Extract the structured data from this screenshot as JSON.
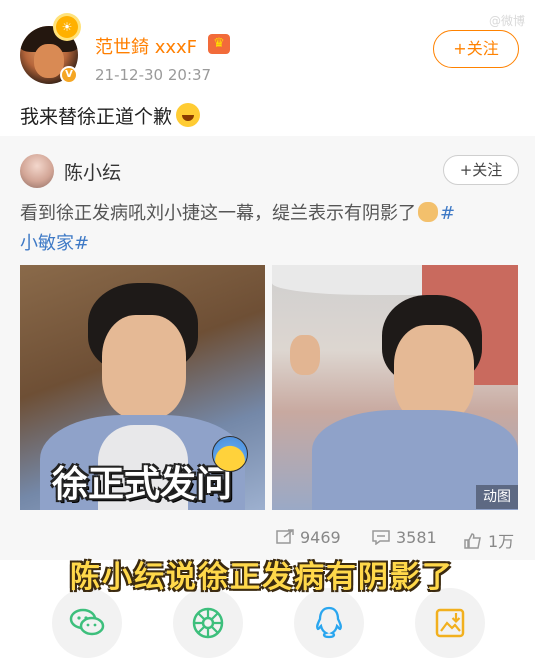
{
  "watermark": "@微博",
  "post": {
    "username": "范世錡 xxxF",
    "timestamp": "21-12-30 20:37",
    "follow_label": "+关注",
    "text": "我来替徐正道个歉"
  },
  "repost": {
    "username": "陈小纭",
    "follow_label": "+关注",
    "text_main": "看到徐正发病吼刘小捷这一幕，缇兰表示有阴影了",
    "hashtag_part1": "#",
    "hashtag_part2": "小敏家#",
    "image_left_caption": "徐正式发问",
    "gif_badge": "动图"
  },
  "stats": {
    "reposts": "9469",
    "comments": "3581",
    "likes": "1万"
  },
  "subtitle": "陈小纭说徐正发病有阴影了",
  "share": {
    "items": [
      "wechat-icon",
      "moments-icon",
      "qq-icon",
      "save-image-icon"
    ]
  },
  "colors": {
    "accent": "#ff8200",
    "hashtag": "#3f7ac6",
    "wechat": "#3dbf7c",
    "moments": "#3dbf7c",
    "qq": "#2aa6ef",
    "save": "#f2b01e"
  }
}
